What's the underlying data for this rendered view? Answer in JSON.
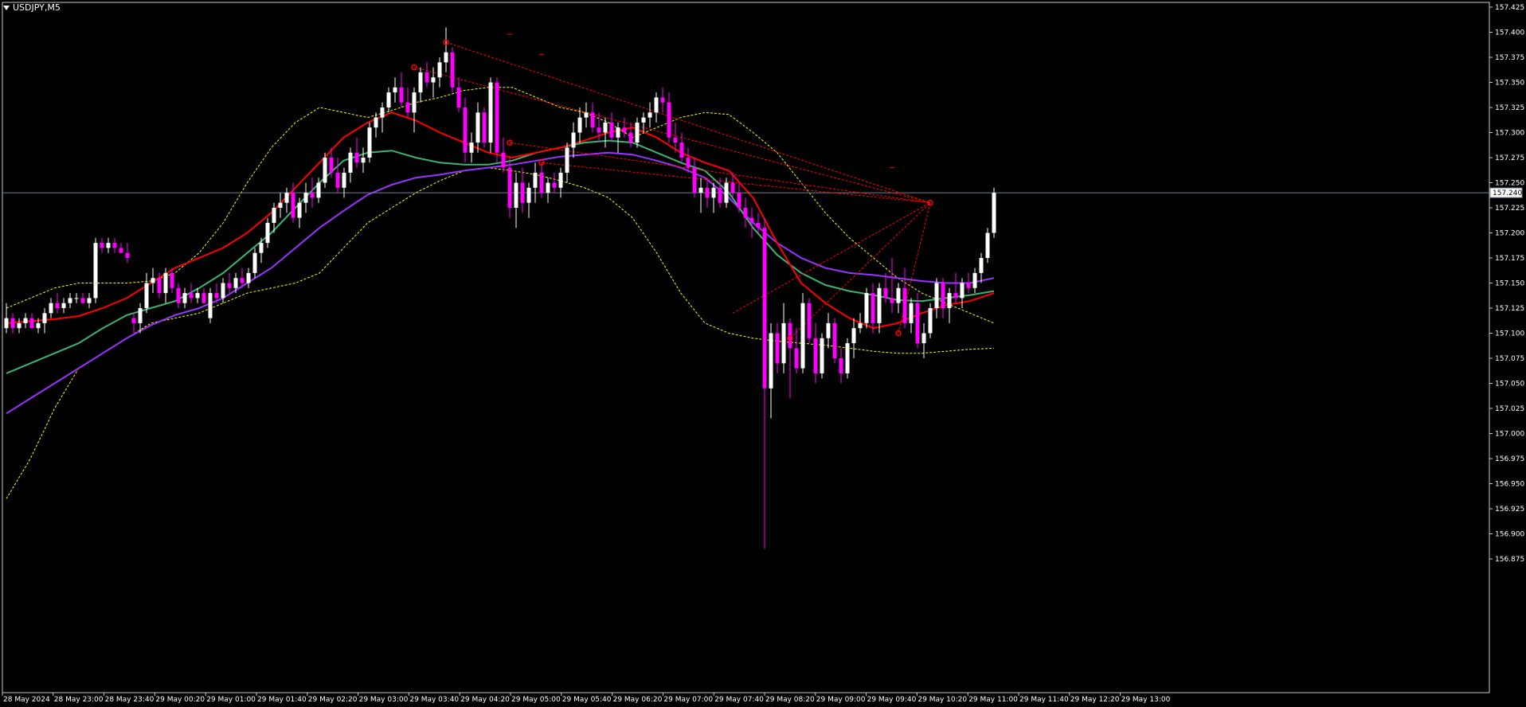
{
  "symbol_label": "USDJPY,M5",
  "colors": {
    "background": "#000000",
    "frame": "#c8c8c8",
    "bull_body": "#ffffff",
    "bear_body": "#ff00ff",
    "wick": "#ffffff",
    "ema_red": "#ff0000",
    "ema_green": "#3cb371",
    "ema_purple": "#9933ff",
    "bollinger": "#ffff00",
    "trendline": "#ff0000",
    "price_line": "#708090",
    "text": "#ffffff"
  },
  "chart_data": {
    "type": "candlestick",
    "symbol": "USDJPY",
    "timeframe": "M5",
    "y_ticks": [
      "156.875",
      "156.900",
      "156.925",
      "156.950",
      "156.975",
      "157.000",
      "157.025",
      "157.050",
      "157.075",
      "157.100",
      "157.125",
      "157.150",
      "157.175",
      "157.200",
      "157.225",
      "157.250",
      "157.275",
      "157.300",
      "157.325",
      "157.350",
      "157.375",
      "157.400",
      "157.425"
    ],
    "x_ticks": [
      "28 May 2024",
      "28 May 23:00",
      "28 May 23:40",
      "29 May 00:20",
      "29 May 01:00",
      "29 May 01:40",
      "29 May 02:20",
      "29 May 03:00",
      "29 May 03:40",
      "29 May 04:20",
      "29 May 05:00",
      "29 May 05:40",
      "29 May 06:20",
      "29 May 07:00",
      "29 May 07:40",
      "29 May 08:20",
      "29 May 09:00",
      "29 May 09:40",
      "29 May 10:20",
      "29 May 11:00",
      "29 May 11:40",
      "29 May 12:20",
      "29 May 13:00"
    ],
    "ylim": [
      156.87,
      157.43
    ],
    "current_price": "157.240",
    "candles_per_tick": 8,
    "ohlc": [
      [
        157.105,
        157.13,
        157.1,
        157.115
      ],
      [
        157.115,
        157.12,
        157.1,
        157.105
      ],
      [
        157.105,
        157.115,
        157.1,
        157.11
      ],
      [
        157.11,
        157.12,
        157.105,
        157.115
      ],
      [
        157.115,
        157.12,
        157.105,
        157.105
      ],
      [
        157.105,
        157.115,
        157.1,
        157.11
      ],
      [
        157.11,
        157.125,
        157.1,
        157.12
      ],
      [
        157.12,
        157.135,
        157.115,
        157.13
      ],
      [
        157.13,
        157.14,
        157.12,
        157.125
      ],
      [
        157.125,
        157.135,
        157.12,
        157.13
      ],
      [
        157.13,
        157.14,
        157.125,
        157.135
      ],
      [
        157.135,
        157.14,
        157.13,
        157.135
      ],
      [
        157.135,
        157.14,
        157.13,
        157.13
      ],
      [
        157.13,
        157.14,
        157.125,
        157.135
      ],
      [
        157.135,
        157.195,
        157.13,
        157.19
      ],
      [
        157.19,
        157.195,
        157.18,
        157.185
      ],
      [
        157.185,
        157.195,
        157.18,
        157.19
      ],
      [
        157.19,
        157.195,
        157.18,
        157.185
      ],
      [
        157.185,
        157.19,
        157.18,
        157.18
      ],
      [
        157.18,
        157.19,
        157.17,
        157.175
      ],
      [
        157.115,
        157.12,
        157.1,
        157.11
      ],
      [
        157.11,
        157.13,
        157.1,
        157.125
      ],
      [
        157.125,
        157.16,
        157.12,
        157.15
      ],
      [
        157.15,
        157.165,
        157.14,
        157.155
      ],
      [
        157.155,
        157.16,
        157.135,
        157.14
      ],
      [
        157.14,
        157.165,
        157.13,
        157.16
      ],
      [
        157.16,
        157.165,
        157.14,
        157.145
      ],
      [
        157.145,
        157.15,
        157.125,
        157.13
      ],
      [
        157.13,
        157.145,
        157.125,
        157.14
      ],
      [
        157.14,
        157.15,
        157.13,
        157.135
      ],
      [
        157.135,
        157.145,
        157.13,
        157.14
      ],
      [
        157.14,
        157.145,
        157.13,
        157.13
      ],
      [
        157.115,
        157.145,
        157.11,
        157.14
      ],
      [
        157.14,
        157.15,
        157.13,
        157.135
      ],
      [
        157.135,
        157.155,
        157.13,
        157.15
      ],
      [
        157.15,
        157.16,
        157.14,
        157.145
      ],
      [
        157.145,
        157.16,
        157.14,
        157.155
      ],
      [
        157.155,
        157.165,
        157.145,
        157.15
      ],
      [
        157.15,
        157.165,
        157.145,
        157.16
      ],
      [
        157.16,
        157.185,
        157.155,
        157.18
      ],
      [
        157.18,
        157.195,
        157.17,
        157.19
      ],
      [
        157.19,
        157.215,
        157.185,
        157.21
      ],
      [
        157.21,
        157.23,
        157.2,
        157.225
      ],
      [
        157.225,
        157.24,
        157.215,
        157.23
      ],
      [
        157.23,
        157.245,
        157.22,
        157.24
      ],
      [
        157.24,
        157.25,
        157.21,
        157.215
      ],
      [
        157.215,
        157.235,
        157.205,
        157.23
      ],
      [
        157.23,
        157.25,
        157.22,
        157.24
      ],
      [
        157.24,
        157.255,
        157.225,
        157.235
      ],
      [
        157.235,
        157.255,
        157.23,
        157.25
      ],
      [
        157.25,
        157.28,
        157.245,
        157.275
      ],
      [
        157.275,
        157.285,
        157.255,
        157.26
      ],
      [
        157.26,
        157.275,
        157.24,
        157.245
      ],
      [
        157.245,
        157.265,
        157.235,
        157.26
      ],
      [
        157.26,
        157.285,
        157.25,
        157.28
      ],
      [
        157.28,
        157.295,
        157.265,
        157.27
      ],
      [
        157.27,
        157.285,
        157.26,
        157.275
      ],
      [
        157.275,
        157.31,
        157.27,
        157.305
      ],
      [
        157.305,
        157.32,
        157.295,
        157.315
      ],
      [
        157.315,
        157.33,
        157.3,
        157.325
      ],
      [
        157.325,
        157.345,
        157.32,
        157.34
      ],
      [
        157.34,
        157.355,
        157.33,
        157.345
      ],
      [
        157.345,
        157.36,
        157.325,
        157.33
      ],
      [
        157.33,
        157.345,
        157.315,
        157.32
      ],
      [
        157.32,
        157.345,
        157.3,
        157.34
      ],
      [
        157.34,
        157.365,
        157.33,
        157.36
      ],
      [
        157.36,
        157.37,
        157.345,
        157.35
      ],
      [
        157.35,
        157.365,
        157.335,
        157.355
      ],
      [
        157.355,
        157.375,
        157.345,
        157.37
      ],
      [
        157.37,
        157.405,
        157.36,
        157.38
      ],
      [
        157.38,
        157.385,
        157.34,
        157.345
      ],
      [
        157.345,
        157.355,
        157.32,
        157.325
      ],
      [
        157.325,
        157.335,
        157.27,
        157.28
      ],
      [
        157.28,
        157.3,
        157.27,
        157.29
      ],
      [
        157.29,
        157.33,
        157.28,
        157.32
      ],
      [
        157.32,
        157.325,
        157.285,
        157.29
      ],
      [
        157.29,
        157.355,
        157.28,
        157.35
      ],
      [
        157.35,
        157.355,
        157.27,
        157.28
      ],
      [
        157.28,
        157.295,
        157.26,
        157.265
      ],
      [
        157.265,
        157.275,
        157.215,
        157.225
      ],
      [
        157.225,
        157.26,
        157.205,
        157.25
      ],
      [
        157.25,
        157.265,
        157.22,
        157.23
      ],
      [
        157.23,
        157.25,
        157.215,
        157.245
      ],
      [
        157.245,
        157.27,
        157.23,
        157.26
      ],
      [
        157.26,
        157.27,
        157.235,
        157.24
      ],
      [
        157.24,
        157.255,
        157.23,
        157.25
      ],
      [
        157.25,
        157.26,
        157.24,
        157.245
      ],
      [
        157.245,
        157.265,
        157.235,
        157.26
      ],
      [
        157.26,
        157.29,
        157.25,
        157.285
      ],
      [
        157.285,
        157.31,
        157.275,
        157.3
      ],
      [
        157.3,
        157.325,
        157.29,
        157.315
      ],
      [
        157.315,
        157.33,
        157.305,
        157.32
      ],
      [
        157.32,
        157.33,
        157.3,
        157.305
      ],
      [
        157.305,
        157.32,
        157.29,
        157.3
      ],
      [
        157.3,
        157.315,
        157.285,
        157.31
      ],
      [
        157.31,
        157.32,
        157.29,
        157.295
      ],
      [
        157.295,
        157.31,
        157.28,
        157.305
      ],
      [
        157.305,
        157.315,
        157.295,
        157.3
      ],
      [
        157.3,
        157.31,
        157.285,
        157.29
      ],
      [
        157.29,
        157.315,
        157.285,
        157.31
      ],
      [
        157.31,
        157.32,
        157.3,
        157.315
      ],
      [
        157.315,
        157.33,
        157.305,
        157.32
      ],
      [
        157.32,
        157.34,
        157.31,
        157.335
      ],
      [
        157.335,
        157.345,
        157.32,
        157.33
      ],
      [
        157.33,
        157.34,
        157.29,
        157.295
      ],
      [
        157.295,
        157.31,
        157.28,
        157.29
      ],
      [
        157.29,
        157.3,
        157.27,
        157.275
      ],
      [
        157.275,
        157.285,
        157.26,
        157.265
      ],
      [
        157.265,
        157.275,
        157.235,
        157.24
      ],
      [
        157.24,
        157.255,
        157.22,
        157.245
      ],
      [
        157.245,
        157.255,
        157.225,
        157.235
      ],
      [
        157.235,
        157.25,
        157.22,
        157.245
      ],
      [
        157.245,
        157.255,
        157.225,
        157.23
      ],
      [
        157.23,
        157.255,
        157.225,
        157.25
      ],
      [
        157.25,
        157.26,
        157.235,
        157.24
      ],
      [
        157.24,
        157.25,
        157.22,
        157.225
      ],
      [
        157.225,
        157.235,
        157.205,
        157.215
      ],
      [
        157.215,
        157.225,
        157.195,
        157.21
      ],
      [
        157.21,
        157.22,
        157.2,
        157.205
      ],
      [
        157.205,
        157.215,
        156.885,
        157.045
      ],
      [
        157.045,
        157.11,
        157.015,
        157.1
      ],
      [
        157.1,
        157.11,
        157.06,
        157.07
      ],
      [
        157.07,
        157.13,
        157.06,
        157.11
      ],
      [
        157.11,
        157.115,
        157.035,
        157.085
      ],
      [
        157.085,
        157.105,
        157.06,
        157.065
      ],
      [
        157.065,
        157.14,
        157.06,
        157.13
      ],
      [
        157.13,
        157.135,
        157.09,
        157.095
      ],
      [
        157.095,
        157.11,
        157.05,
        157.06
      ],
      [
        157.06,
        157.1,
        157.055,
        157.095
      ],
      [
        157.095,
        157.12,
        157.085,
        157.11
      ],
      [
        157.11,
        157.115,
        157.07,
        157.075
      ],
      [
        157.075,
        157.085,
        157.05,
        157.06
      ],
      [
        157.06,
        157.095,
        157.055,
        157.09
      ],
      [
        157.09,
        157.115,
        157.075,
        157.105
      ],
      [
        157.105,
        157.12,
        157.1,
        157.11
      ],
      [
        157.11,
        157.145,
        157.105,
        157.14
      ],
      [
        157.14,
        157.15,
        157.1,
        157.11
      ],
      [
        157.11,
        157.15,
        157.1,
        157.145
      ],
      [
        157.145,
        157.16,
        157.13,
        157.135
      ],
      [
        157.135,
        157.175,
        157.12,
        157.13
      ],
      [
        157.13,
        157.15,
        157.12,
        157.145
      ],
      [
        157.145,
        157.165,
        157.105,
        157.11
      ],
      [
        157.11,
        157.135,
        157.1,
        157.13
      ],
      [
        157.13,
        157.14,
        157.085,
        157.09
      ],
      [
        157.09,
        157.11,
        157.075,
        157.1
      ],
      [
        157.1,
        157.13,
        157.095,
        157.125
      ],
      [
        157.125,
        157.155,
        157.115,
        157.15
      ],
      [
        157.15,
        157.155,
        157.115,
        157.125
      ],
      [
        157.125,
        157.145,
        157.11,
        157.14
      ],
      [
        157.14,
        157.16,
        157.13,
        157.135
      ],
      [
        157.135,
        157.155,
        157.125,
        157.15
      ],
      [
        157.15,
        157.16,
        157.14,
        157.145
      ],
      [
        157.145,
        157.165,
        157.14,
        157.16
      ],
      [
        157.16,
        157.18,
        157.15,
        157.175
      ],
      [
        157.175,
        157.205,
        157.17,
        157.2
      ],
      [
        157.2,
        157.245,
        157.195,
        157.24
      ]
    ],
    "ema_red": [
      157.11,
      157.112,
      157.114,
      157.117,
      157.125,
      157.135,
      157.15,
      157.165,
      157.175,
      157.185,
      157.2,
      157.22,
      157.245,
      157.27,
      157.295,
      157.31,
      157.32,
      157.312,
      157.3,
      157.29,
      157.28,
      157.275,
      157.28,
      157.285,
      157.292,
      157.3,
      157.305,
      157.295,
      157.28,
      157.27,
      157.262,
      157.235,
      157.19,
      157.15,
      157.13,
      157.115,
      157.105,
      157.11,
      157.12,
      157.128,
      157.132,
      157.14
    ],
    "ema_green": [
      157.06,
      157.07,
      157.08,
      157.09,
      157.105,
      157.118,
      157.125,
      157.132,
      157.145,
      157.16,
      157.18,
      157.2,
      157.225,
      157.25,
      157.272,
      157.28,
      157.282,
      157.275,
      157.27,
      157.268,
      157.268,
      157.272,
      157.28,
      157.285,
      157.29,
      157.292,
      157.29,
      157.28,
      157.27,
      157.262,
      157.24,
      157.205,
      157.178,
      157.16,
      157.148,
      157.142,
      157.138,
      157.133,
      157.132,
      157.135,
      157.138,
      157.142
    ],
    "ema_purple": [
      157.02,
      157.035,
      157.05,
      157.065,
      157.08,
      157.095,
      157.108,
      157.118,
      157.125,
      157.135,
      157.15,
      157.165,
      157.185,
      157.205,
      157.222,
      157.238,
      157.248,
      157.255,
      157.258,
      157.262,
      157.265,
      157.268,
      157.272,
      157.276,
      157.278,
      157.28,
      157.278,
      157.272,
      157.265,
      157.255,
      157.235,
      157.21,
      157.19,
      157.175,
      157.165,
      157.16,
      157.158,
      157.155,
      157.152,
      157.15,
      157.15,
      157.155
    ],
    "bb_upper": [
      157.125,
      157.135,
      157.145,
      157.15,
      157.15,
      157.15,
      157.152,
      157.16,
      157.18,
      157.21,
      157.25,
      157.285,
      157.31,
      157.325,
      157.32,
      157.315,
      157.322,
      157.33,
      157.335,
      157.342,
      157.345,
      157.345,
      157.335,
      157.325,
      157.32,
      157.31,
      157.295,
      157.305,
      157.315,
      157.32,
      157.318,
      157.3,
      157.28,
      157.25,
      157.22,
      157.195,
      157.175,
      157.155,
      157.14,
      157.13,
      157.12,
      157.11
    ],
    "bb_lower": [
      156.935,
      156.975,
      157.025,
      157.065,
      157.08,
      157.095,
      157.11,
      157.115,
      157.12,
      157.13,
      157.14,
      157.145,
      157.15,
      157.16,
      157.185,
      157.21,
      157.225,
      157.24,
      157.252,
      157.262,
      157.265,
      157.262,
      157.258,
      157.252,
      157.245,
      157.235,
      157.215,
      157.18,
      157.14,
      157.11,
      157.1,
      157.095,
      157.092,
      157.09,
      157.088,
      157.085,
      157.082,
      157.08,
      157.08,
      157.082,
      157.084,
      157.085
    ],
    "trendlines": [
      {
        "from": [
          69,
          157.39
        ],
        "to": [
          145,
          157.23
        ]
      },
      {
        "from": [
          64,
          157.365
        ],
        "to": [
          145,
          157.23
        ]
      },
      {
        "from": [
          79,
          157.29
        ],
        "to": [
          145,
          157.23
        ]
      },
      {
        "from": [
          84,
          157.27
        ],
        "to": [
          145,
          157.23
        ]
      },
      {
        "from": [
          114,
          157.12
        ],
        "to": [
          145,
          157.23
        ]
      },
      {
        "from": [
          123,
          157.095
        ],
        "to": [
          145,
          157.23
        ]
      },
      {
        "from": [
          140,
          157.1
        ],
        "to": [
          145,
          157.23
        ]
      }
    ],
    "markers": [
      [
        69,
        157.39
      ],
      [
        64,
        157.365
      ],
      [
        79,
        157.29
      ],
      [
        84,
        157.27
      ],
      [
        123,
        157.095
      ],
      [
        140,
        157.1
      ],
      [
        145,
        157.23
      ]
    ],
    "dashes": [
      [
        79,
        157.398
      ],
      [
        84,
        157.378
      ],
      [
        139,
        157.265
      ]
    ]
  }
}
